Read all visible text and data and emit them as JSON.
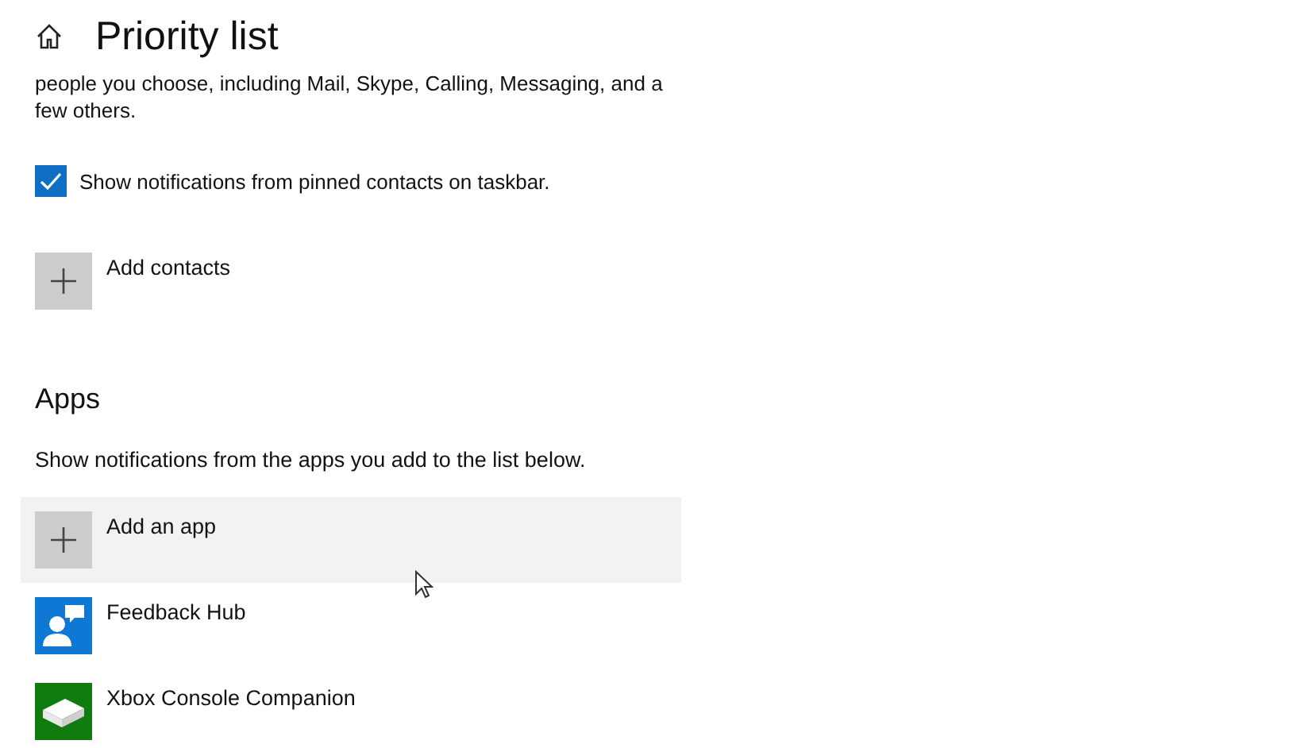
{
  "header": {
    "title": "Priority list"
  },
  "intro": {
    "text": "people you choose, including Mail, Skype, Calling, Messaging, and a few others."
  },
  "pinned_checkbox": {
    "label": "Show notifications from pinned contacts on taskbar.",
    "checked": true
  },
  "add_contacts": {
    "label": "Add contacts"
  },
  "apps": {
    "heading": "Apps",
    "description": "Show notifications from the apps you add to the list below.",
    "items": [
      {
        "kind": "add",
        "label": "Add an app",
        "highlighted": true
      },
      {
        "kind": "app",
        "label": "Feedback Hub",
        "color": "#0f78d4",
        "highlighted": false
      },
      {
        "kind": "app",
        "label": "Xbox Console Companion",
        "color": "#107c10",
        "highlighted": false
      }
    ]
  }
}
